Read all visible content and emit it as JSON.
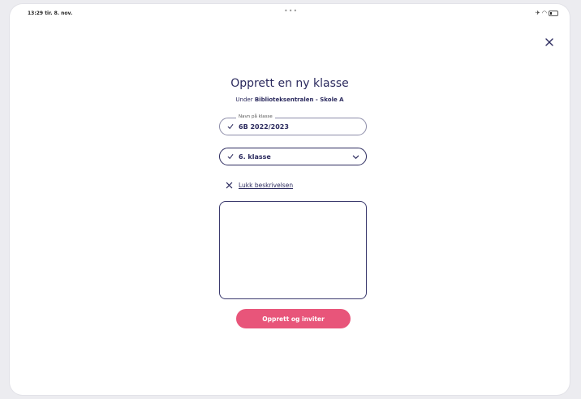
{
  "status_bar": {
    "time": "13:29  tir. 8. nov.",
    "dots": "•••",
    "icons": "✈ ◠"
  },
  "modal": {
    "title": "Opprett en ny klasse",
    "subtitle_prefix": "Under ",
    "subtitle_org": "Biblioteksentralen - Skole A",
    "name_field": {
      "label": "Navn på klasse",
      "value": "6B 2022/2023"
    },
    "grade_select": {
      "selected": "6. klasse"
    },
    "description_toggle": {
      "label": "Lukk beskrivelsen"
    },
    "description": {
      "value": ""
    },
    "submit_label": "Opprett og inviter"
  },
  "colors": {
    "primary_text": "#2b2a5e",
    "accent": "#e8557a",
    "border": "#3b3a6e"
  },
  "icons": {
    "close": "close-icon",
    "check": "check-icon",
    "chevron": "chevron-down-icon",
    "toggle": "x-icon"
  }
}
